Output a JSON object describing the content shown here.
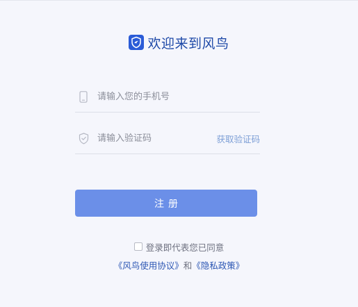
{
  "header": {
    "title": "欢迎来到风鸟",
    "logo_icon": "shield-logo-icon",
    "brand_color": "#2a5bd7"
  },
  "form": {
    "phone_placeholder": "请输入您的手机号",
    "phone_value": "",
    "code_placeholder": "请输入验证码",
    "code_value": "",
    "get_code_label": "获取验证码",
    "submit_label": "注册",
    "accent_color": "#6b8fe8"
  },
  "agreement": {
    "checkbox_label": "登录即代表您已同意",
    "checked": false,
    "terms_link": "《风鸟使用协议》",
    "and_text": "和",
    "privacy_link": "《隐私政策》"
  }
}
